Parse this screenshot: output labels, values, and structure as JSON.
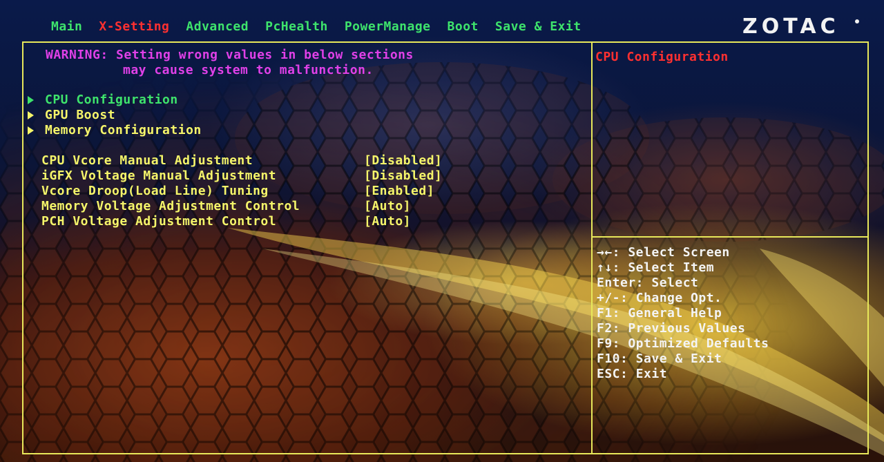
{
  "menu": {
    "tabs": [
      {
        "label": "Main"
      },
      {
        "label": "X-Setting"
      },
      {
        "label": "Advanced"
      },
      {
        "label": "PcHealth"
      },
      {
        "label": "PowerManage"
      },
      {
        "label": "Boot"
      },
      {
        "label": "Save & Exit"
      }
    ],
    "active_tab": "X-Setting"
  },
  "brand": {
    "logo_text": "ZOTAC"
  },
  "warning": {
    "line1": "WARNING: Setting wrong values in below sections",
    "line2": "may cause system to malfunction."
  },
  "submenus": [
    {
      "label": "CPU Configuration"
    },
    {
      "label": "GPU Boost"
    },
    {
      "label": "Memory Configuration"
    }
  ],
  "settings": [
    {
      "label": "CPU Vcore Manual Adjustment",
      "value": "[Disabled]"
    },
    {
      "label": "iGFX Voltage Manual Adjustment",
      "value": "[Disabled]"
    },
    {
      "label": "Vcore Droop(Load Line) Tuning",
      "value": "[Enabled]"
    },
    {
      "label": "Memory Voltage Adjustment Control",
      "value": "[Auto]"
    },
    {
      "label": "PCH Voltage Adjustment Control",
      "value": "[Auto]"
    }
  ],
  "help": {
    "title": "CPU Configuration"
  },
  "key_help": [
    "→←: Select Screen",
    "↑↓: Select Item",
    "Enter: Select",
    "+/-: Change Opt.",
    "F1: General Help",
    "F2: Previous Values",
    "F9: Optimized Defaults",
    "F10: Save & Exit",
    "ESC: Exit"
  ],
  "colors": {
    "frame": "#e8e85a",
    "tab_text": "#3ee36c",
    "active_tab": "#ff3030",
    "warning": "#e040e8",
    "item_text": "#f5f56a",
    "selected_item": "#3ee36c",
    "help_title": "#ff3030",
    "key_help": "#f4f4f4"
  }
}
